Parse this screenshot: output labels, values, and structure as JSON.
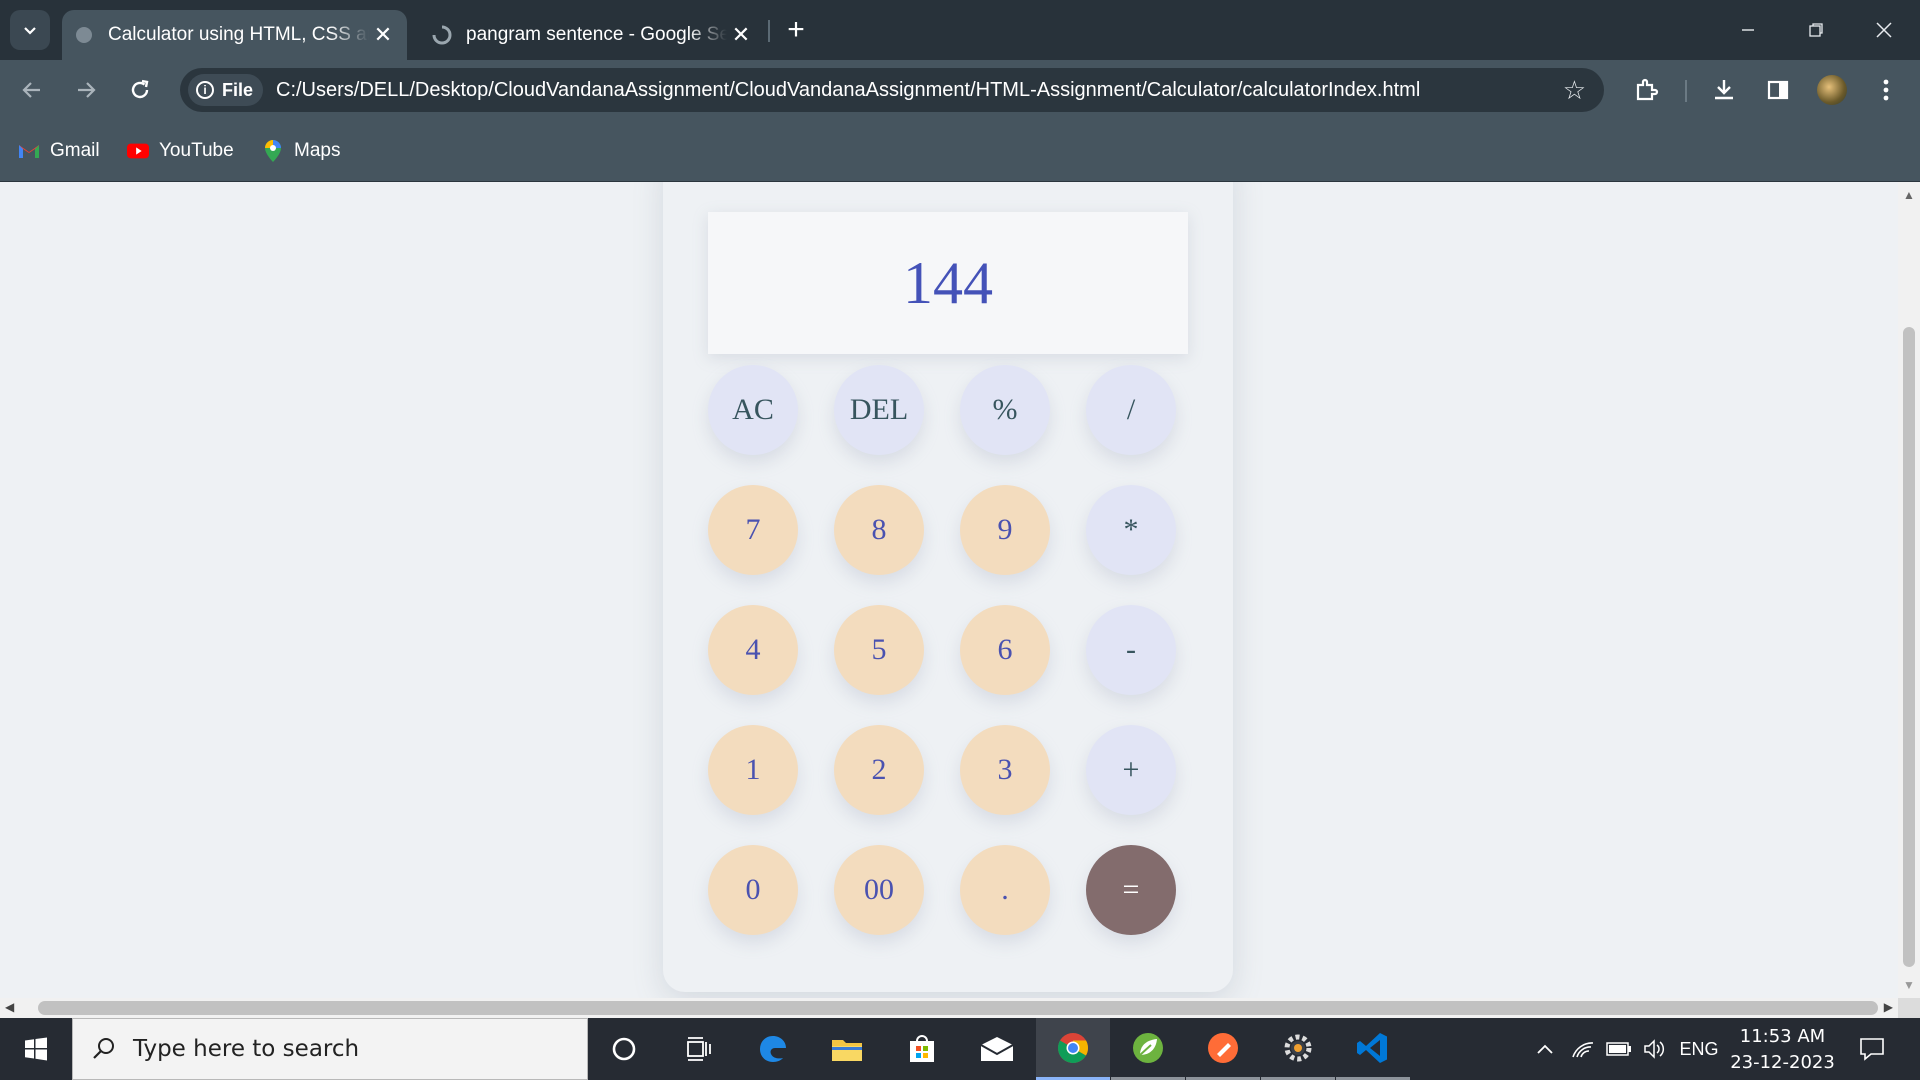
{
  "browser": {
    "tabs": [
      {
        "title": "Calculator using HTML, CSS and",
        "active": true
      },
      {
        "title": "pangram sentence - Google Search",
        "active": false
      }
    ],
    "address_chip": "File",
    "url": "C:/Users/DELL/Desktop/CloudVandanaAssignment/CloudVandanaAssignment/HTML-Assignment/Calculator/calculatorIndex.html",
    "bookmarks": [
      "Gmail",
      "YouTube",
      "Maps"
    ]
  },
  "calculator": {
    "display": "144",
    "keys": [
      {
        "label": "AC",
        "kind": "op"
      },
      {
        "label": "DEL",
        "kind": "op"
      },
      {
        "label": "%",
        "kind": "op"
      },
      {
        "label": "/",
        "kind": "op"
      },
      {
        "label": "7",
        "kind": "num"
      },
      {
        "label": "8",
        "kind": "num"
      },
      {
        "label": "9",
        "kind": "num"
      },
      {
        "label": "*",
        "kind": "op"
      },
      {
        "label": "4",
        "kind": "num"
      },
      {
        "label": "5",
        "kind": "num"
      },
      {
        "label": "6",
        "kind": "num"
      },
      {
        "label": "-",
        "kind": "op"
      },
      {
        "label": "1",
        "kind": "num"
      },
      {
        "label": "2",
        "kind": "num"
      },
      {
        "label": "3",
        "kind": "num"
      },
      {
        "label": "+",
        "kind": "op"
      },
      {
        "label": "0",
        "kind": "num"
      },
      {
        "label": "00",
        "kind": "num"
      },
      {
        "label": ".",
        "kind": "num"
      },
      {
        "label": "=",
        "kind": "eq"
      }
    ]
  },
  "taskbar": {
    "search_placeholder": "Type here to search",
    "language": "ENG",
    "time": "11:53 AM",
    "date": "23-12-2023"
  },
  "colors": {
    "chrome_dark": "#28323a",
    "chrome_toolbar": "#46555f",
    "display_text": "#4452b8",
    "op_key": "#e1e4f5",
    "num_key": "#f3dcbe",
    "equals_key": "#836c6d"
  }
}
